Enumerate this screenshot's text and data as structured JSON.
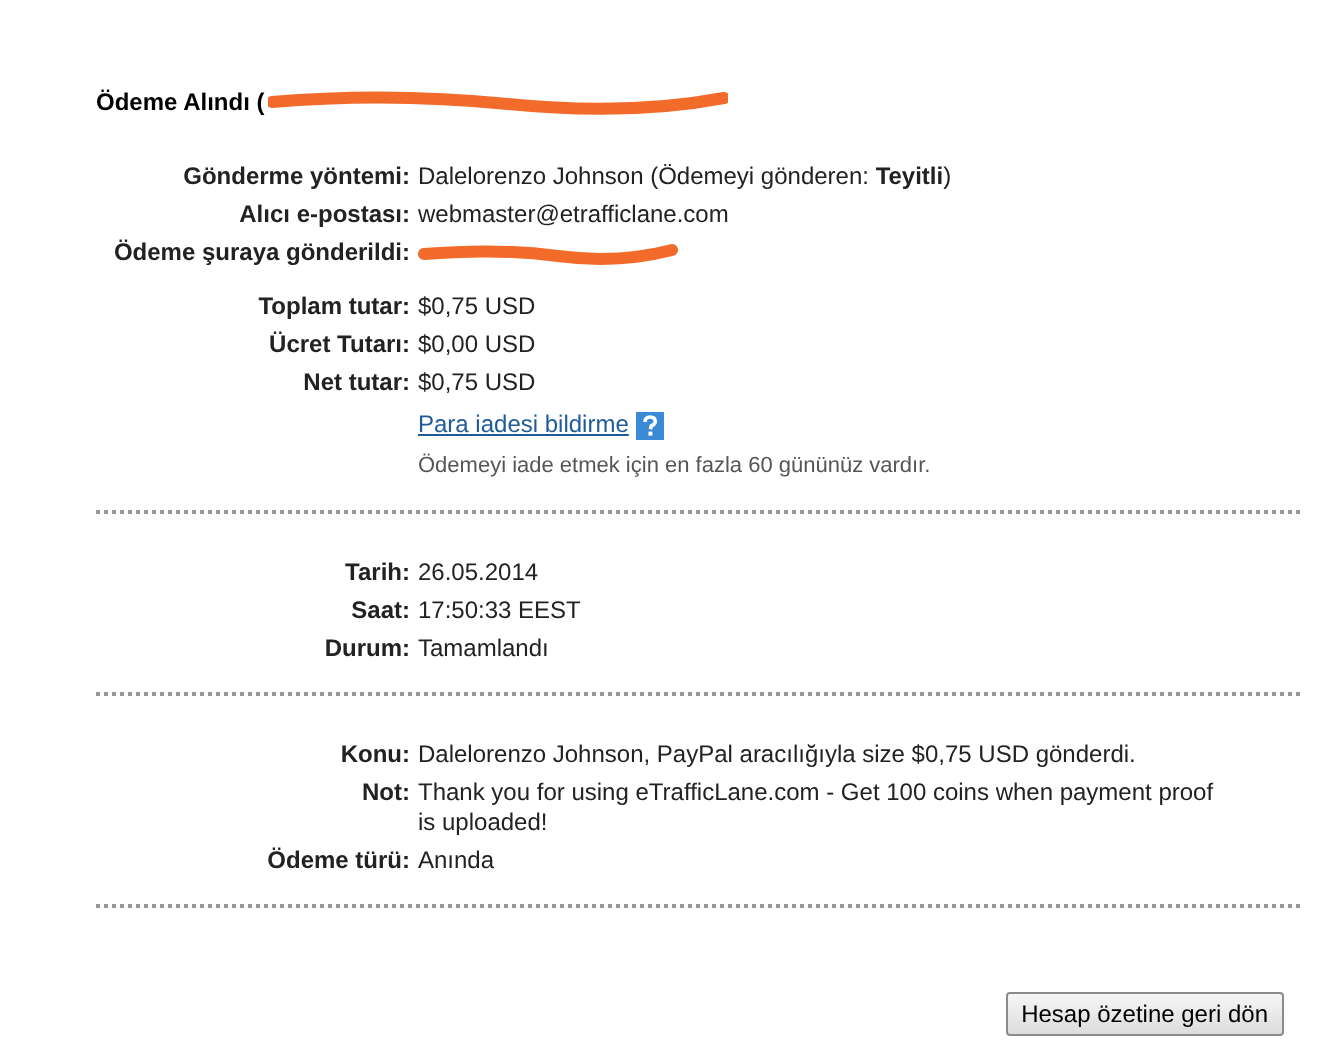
{
  "title": {
    "text": "Ödeme Alındı (",
    "redacted": true
  },
  "sections": [
    {
      "groups": [
        {
          "rows": [
            {
              "label": "Gönderme yöntemi:",
              "value": "Dalelorenzo Johnson (Ödemeyi gönderen: **Teyitli**)"
            },
            {
              "label": "Alıcı e-postası:",
              "value": "webmaster@etrafficlane.com"
            },
            {
              "label": "Ödeme şuraya gönderildi:",
              "value": "",
              "redacted": true
            }
          ]
        },
        {
          "rows": [
            {
              "label": "Toplam tutar:",
              "value": "$0,75 USD"
            },
            {
              "label": "Ücret Tutarı:",
              "value": "$0,00 USD"
            },
            {
              "label": "Net tutar:",
              "value": "$0,75 USD"
            }
          ]
        }
      ],
      "link": "Para iadesi bildirme",
      "note": "Ödemeyi iade etmek için en fazla 60 gününüz vardır."
    },
    {
      "groups": [
        {
          "rows": [
            {
              "label": "Tarih:",
              "value": "26.05.2014"
            },
            {
              "label": "Saat:",
              "value": "17:50:33 EEST"
            },
            {
              "label": "Durum:",
              "value": "Tamamlandı"
            }
          ]
        }
      ]
    },
    {
      "groups": [
        {
          "rows": [
            {
              "label": "Konu:",
              "value": "Dalelorenzo Johnson, PayPal aracılığıyla size $0,75 USD gönderdi."
            },
            {
              "label": "Not:",
              "value": "Thank you for using eTrafficLane.com - Get 100 coins when payment proof is uploaded!"
            },
            {
              "label": "Ödeme türü:",
              "value": "Anında"
            }
          ]
        }
      ]
    }
  ],
  "button": "Hesap özetine geri dön"
}
